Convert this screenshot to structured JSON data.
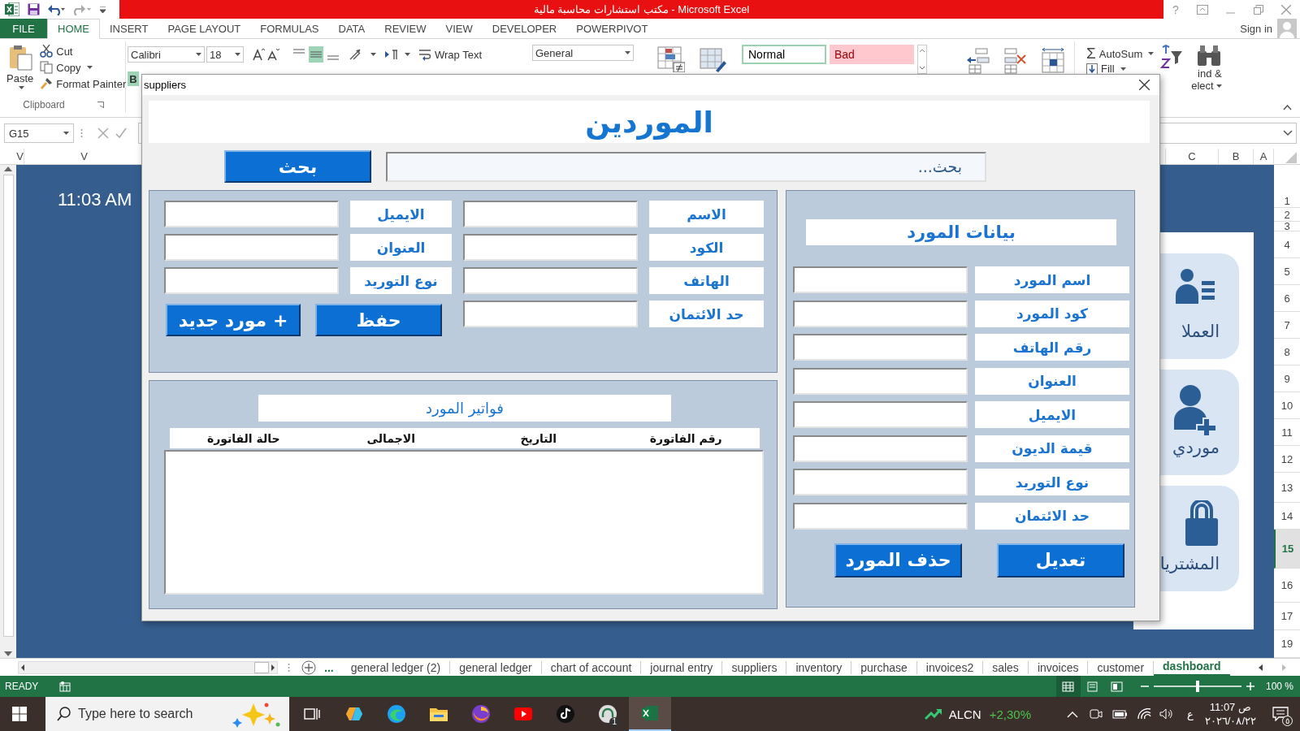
{
  "title_bar": {
    "title": "مكتب استشارات محاسبة مالية - Microsoft Excel",
    "help": "?"
  },
  "ribbon_tabs": [
    {
      "label": "POWERPIVOT",
      "kind": "tab",
      "selected": false
    },
    {
      "label": "DEVELOPER",
      "kind": "tab",
      "selected": false
    },
    {
      "label": "VIEW",
      "kind": "tab",
      "selected": false
    },
    {
      "label": "REVIEW",
      "kind": "tab",
      "selected": false
    },
    {
      "label": "DATA",
      "kind": "tab",
      "selected": false
    },
    {
      "label": "FORMULAS",
      "kind": "tab",
      "selected": false
    },
    {
      "label": "PAGE LAYOUT",
      "kind": "tab",
      "selected": false
    },
    {
      "label": "INSERT",
      "kind": "tab",
      "selected": false
    },
    {
      "label": "HOME",
      "kind": "tab",
      "selected": true
    },
    {
      "label": "FILE",
      "kind": "file",
      "selected": false
    }
  ],
  "sign_in": "Sign in",
  "ribbon": {
    "paste": "Paste",
    "cut": "Cut",
    "copy": "Copy",
    "format_painter": "Format Painter",
    "clipboard": "Clipboard",
    "font": "Calibri",
    "font_size": "18",
    "bold": {
      "label": "B",
      "on": true
    },
    "align": [
      {
        "selected": false
      },
      {
        "selected": true
      },
      {
        "selected": false
      }
    ],
    "wrap_text": "Wrap Text",
    "number_format": "General",
    "styles": [
      {
        "label": "Bad",
        "kind": "bad"
      },
      {
        "label": "Normal",
        "kind": "normal"
      }
    ],
    "autosum_symbol": "Σ",
    "autosum": "AutoSum",
    "fill": "Fill",
    "find_select": [
      "ind &",
      "elect"
    ]
  },
  "name_box": "G15",
  "columns_left": [
    "V",
    "V"
  ],
  "columns_right": [
    "A",
    "B",
    "C"
  ],
  "rows": [
    {
      "label": "1",
      "selected": false
    },
    {
      "label": "2",
      "selected": false
    },
    {
      "label": "3",
      "selected": false
    },
    {
      "label": "4",
      "selected": false
    },
    {
      "label": "5",
      "selected": false
    },
    {
      "label": "6",
      "selected": false
    },
    {
      "label": "7",
      "selected": false
    },
    {
      "label": "8",
      "selected": false
    },
    {
      "label": "9",
      "selected": false
    },
    {
      "label": "10",
      "selected": false
    },
    {
      "label": "11",
      "selected": false
    },
    {
      "label": "12",
      "selected": false
    },
    {
      "label": "13",
      "selected": false
    },
    {
      "label": "14",
      "selected": false
    },
    {
      "label": "15",
      "selected": true
    },
    {
      "label": "16",
      "selected": false
    },
    {
      "label": "17",
      "selected": false
    },
    {
      "label": "19",
      "selected": false
    }
  ],
  "sheet": {
    "time": "11:03 AM",
    "cards": [
      {
        "label": "العملا",
        "kind": "customers"
      },
      {
        "label": "موردي",
        "kind": "suppliers"
      },
      {
        "label": "المشتريا",
        "kind": "purchases"
      }
    ]
  },
  "dialog": {
    "title": "suppliers",
    "heading": "الموردين",
    "search_button": "بحث",
    "search_placeholder": "بحث...",
    "form": {
      "fields": [
        "الاسم",
        "الايميل",
        "الكود",
        "العنوان",
        "الهاتف",
        "نوع التوريد",
        "حد الائتمان"
      ],
      "buttons": [
        "حفظ",
        "+ مورد جديد"
      ]
    },
    "invoices": {
      "title": "فواتير المورد",
      "columns": [
        "رقم الفاتورة",
        "التاريخ",
        "الاجمالى",
        "حالة الفاتورة"
      ]
    },
    "details": {
      "title": "بيانات المورد",
      "fields": [
        "اسم المورد",
        "كود المورد",
        "رقم الهاتف",
        "العنوان",
        "الايميل",
        "قيمة الديون",
        "نوع التوريد",
        "حد الائتمان"
      ],
      "buttons": [
        "تعديل",
        "حذف المورد"
      ]
    }
  },
  "tabs_more": "...",
  "sheet_tabs": [
    {
      "label": "dashboard",
      "selected": true
    },
    {
      "label": "customer",
      "selected": false
    },
    {
      "label": "invoices",
      "selected": false
    },
    {
      "label": "sales",
      "selected": false
    },
    {
      "label": "invoices2",
      "selected": false
    },
    {
      "label": "purchase",
      "selected": false
    },
    {
      "label": "inventory",
      "selected": false
    },
    {
      "label": "suppliers",
      "selected": false
    },
    {
      "label": "journal entry",
      "selected": false
    },
    {
      "label": "chart of account",
      "selected": false
    },
    {
      "label": "general ledger",
      "selected": false
    },
    {
      "label": "general ledger (2)",
      "selected": false
    }
  ],
  "status_bar": {
    "mode": "READY",
    "views": [
      {
        "selected": true
      },
      {
        "selected": false
      },
      {
        "selected": false
      }
    ],
    "zoom": {
      "level": 0.5
    },
    "zoom_text": "100 %"
  },
  "taskbar": {
    "search_placeholder": "Type here to search",
    "app_badge": "1",
    "stock": "ALCN",
    "change": "+2,30%",
    "language": "ع",
    "time": "11:07 ص",
    "date": "٢٠٢٦/٠٨/٢٢",
    "notifications": "٥"
  }
}
